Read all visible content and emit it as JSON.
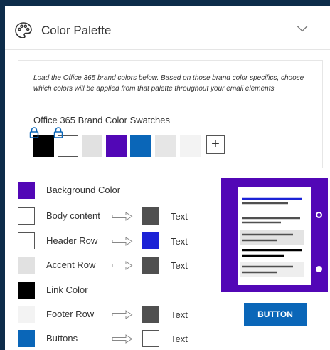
{
  "header": {
    "title": "Color Palette",
    "palette_icon": "palette-icon",
    "collapse_icon": "chevron-down-icon"
  },
  "brand": {
    "description": "Load the Office 365 brand colors below. Based on those brand color specifics, choose which colors will be applied from that palette throughout your email elements",
    "swatches_title": "Office 365 Brand Color Swatches",
    "swatch_colors": [
      "#000000",
      "#ffffff",
      "#e1e1e1",
      "#5207b6",
      "#0a66b8",
      "#e6e6e6",
      "#f3f3f3"
    ],
    "locked": [
      true,
      true,
      false,
      false,
      false,
      false,
      false
    ],
    "add_label": "+"
  },
  "elements": [
    {
      "label": "Background Color",
      "color": "#5207b6"
    },
    {
      "label": "Body content",
      "color": "#ffffff",
      "text_label": "Text",
      "text_color": "#505050"
    },
    {
      "label": "Header Row",
      "color": "#ffffff",
      "text_label": "Text",
      "text_color": "#1b22d6"
    },
    {
      "label": "Accent Row",
      "color": "#e1e1e1",
      "text_label": "Text",
      "text_color": "#505050"
    },
    {
      "label": "Link Color",
      "color": "#000000"
    },
    {
      "label": "Footer Row",
      "color": "#f3f3f3",
      "text_label": "Text",
      "text_color": "#505050"
    },
    {
      "label": "Buttons",
      "color": "#0a66b8",
      "text_label": "Text",
      "text_color": "#ffffff"
    }
  ],
  "preview": {
    "background": "#5207b6",
    "button_label": "BUTTON",
    "button_color": "#0a66b8"
  }
}
